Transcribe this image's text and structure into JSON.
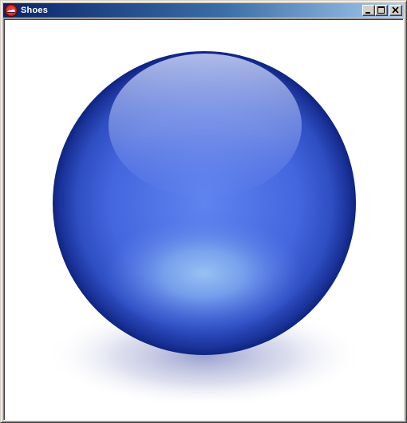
{
  "window": {
    "title": "Shoes",
    "app_icon": "shoes-app-icon"
  },
  "caption_buttons": {
    "minimize_icon": "minimize-icon",
    "maximize_icon": "maximize-icon",
    "close_icon": "close-icon"
  },
  "canvas": {
    "background_color": "#ffffff",
    "sphere": {
      "rim_color": "#0f2480",
      "body_color": "#3d60d6",
      "center_glow_color": "#86b2f0",
      "highlight_color": "#b6c3ee",
      "shadow_color": "#4a55a8"
    }
  }
}
